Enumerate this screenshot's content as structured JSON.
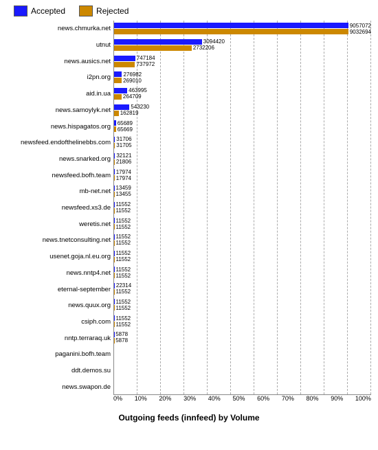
{
  "legend": {
    "accepted_label": "Accepted",
    "rejected_label": "Rejected"
  },
  "chart_title": "Outgoing feeds (innfeed) by Volume",
  "x_labels": [
    "0%",
    "10%",
    "20%",
    "30%",
    "40%",
    "50%",
    "60%",
    "70%",
    "80%",
    "90%",
    "100%"
  ],
  "bars": [
    {
      "name": "news.chmurka.net",
      "accepted": 9057072,
      "rejected": 9032694,
      "acc_pct": 99.7,
      "rej_pct": 99.4
    },
    {
      "name": "utnut",
      "accepted": 3094420,
      "rejected": 2732206,
      "acc_pct": 34.1,
      "rej_pct": 30.1
    },
    {
      "name": "news.ausics.net",
      "accepted": 747184,
      "rejected": 737972,
      "acc_pct": 8.2,
      "rej_pct": 8.1
    },
    {
      "name": "i2pn.org",
      "accepted": 276982,
      "rejected": 269010,
      "acc_pct": 3.05,
      "rej_pct": 2.96
    },
    {
      "name": "aid.in.ua",
      "accepted": 463995,
      "rejected": 264709,
      "acc_pct": 5.1,
      "rej_pct": 2.9
    },
    {
      "name": "news.samoylyk.net",
      "accepted": 543230,
      "rejected": 162819,
      "acc_pct": 5.98,
      "rej_pct": 1.79
    },
    {
      "name": "news.hispagatos.org",
      "accepted": 65689,
      "rejected": 65669,
      "acc_pct": 0.72,
      "rej_pct": 0.72
    },
    {
      "name": "newsfeed.endofthelinebbs.com",
      "accepted": 31706,
      "rejected": 31705,
      "acc_pct": 0.35,
      "rej_pct": 0.35
    },
    {
      "name": "news.snarked.org",
      "accepted": 32121,
      "rejected": 21806,
      "acc_pct": 0.35,
      "rej_pct": 0.24
    },
    {
      "name": "newsfeed.bofh.team",
      "accepted": 17974,
      "rejected": 17974,
      "acc_pct": 0.198,
      "rej_pct": 0.198
    },
    {
      "name": "mb-net.net",
      "accepted": 13459,
      "rejected": 13455,
      "acc_pct": 0.148,
      "rej_pct": 0.148
    },
    {
      "name": "newsfeed.xs3.de",
      "accepted": 11552,
      "rejected": 11552,
      "acc_pct": 0.127,
      "rej_pct": 0.127
    },
    {
      "name": "weretis.net",
      "accepted": 11552,
      "rejected": 11552,
      "acc_pct": 0.127,
      "rej_pct": 0.127
    },
    {
      "name": "news.tnetconsulting.net",
      "accepted": 11552,
      "rejected": 11552,
      "acc_pct": 0.127,
      "rej_pct": 0.127
    },
    {
      "name": "usenet.goja.nl.eu.org",
      "accepted": 11552,
      "rejected": 11552,
      "acc_pct": 0.127,
      "rej_pct": 0.127
    },
    {
      "name": "news.nntp4.net",
      "accepted": 11552,
      "rejected": 11552,
      "acc_pct": 0.127,
      "rej_pct": 0.127
    },
    {
      "name": "eternal-september",
      "accepted": 22314,
      "rejected": 11552,
      "acc_pct": 0.246,
      "rej_pct": 0.127
    },
    {
      "name": "news.quux.org",
      "accepted": 11552,
      "rejected": 11552,
      "acc_pct": 0.127,
      "rej_pct": 0.127
    },
    {
      "name": "csiph.com",
      "accepted": 11552,
      "rejected": 11552,
      "acc_pct": 0.127,
      "rej_pct": 0.127
    },
    {
      "name": "nntp.terraraq.uk",
      "accepted": 5878,
      "rejected": 5878,
      "acc_pct": 0.065,
      "rej_pct": 0.065
    },
    {
      "name": "paganini.bofh.team",
      "accepted": 0,
      "rejected": 0,
      "acc_pct": 0,
      "rej_pct": 0
    },
    {
      "name": "ddt.demos.su",
      "accepted": 0,
      "rejected": 0,
      "acc_pct": 0,
      "rej_pct": 0
    },
    {
      "name": "news.swapon.de",
      "accepted": 0,
      "rejected": 0,
      "acc_pct": 0,
      "rej_pct": 0
    }
  ],
  "colors": {
    "accepted": "#1a1aff",
    "rejected": "#cc8800"
  }
}
